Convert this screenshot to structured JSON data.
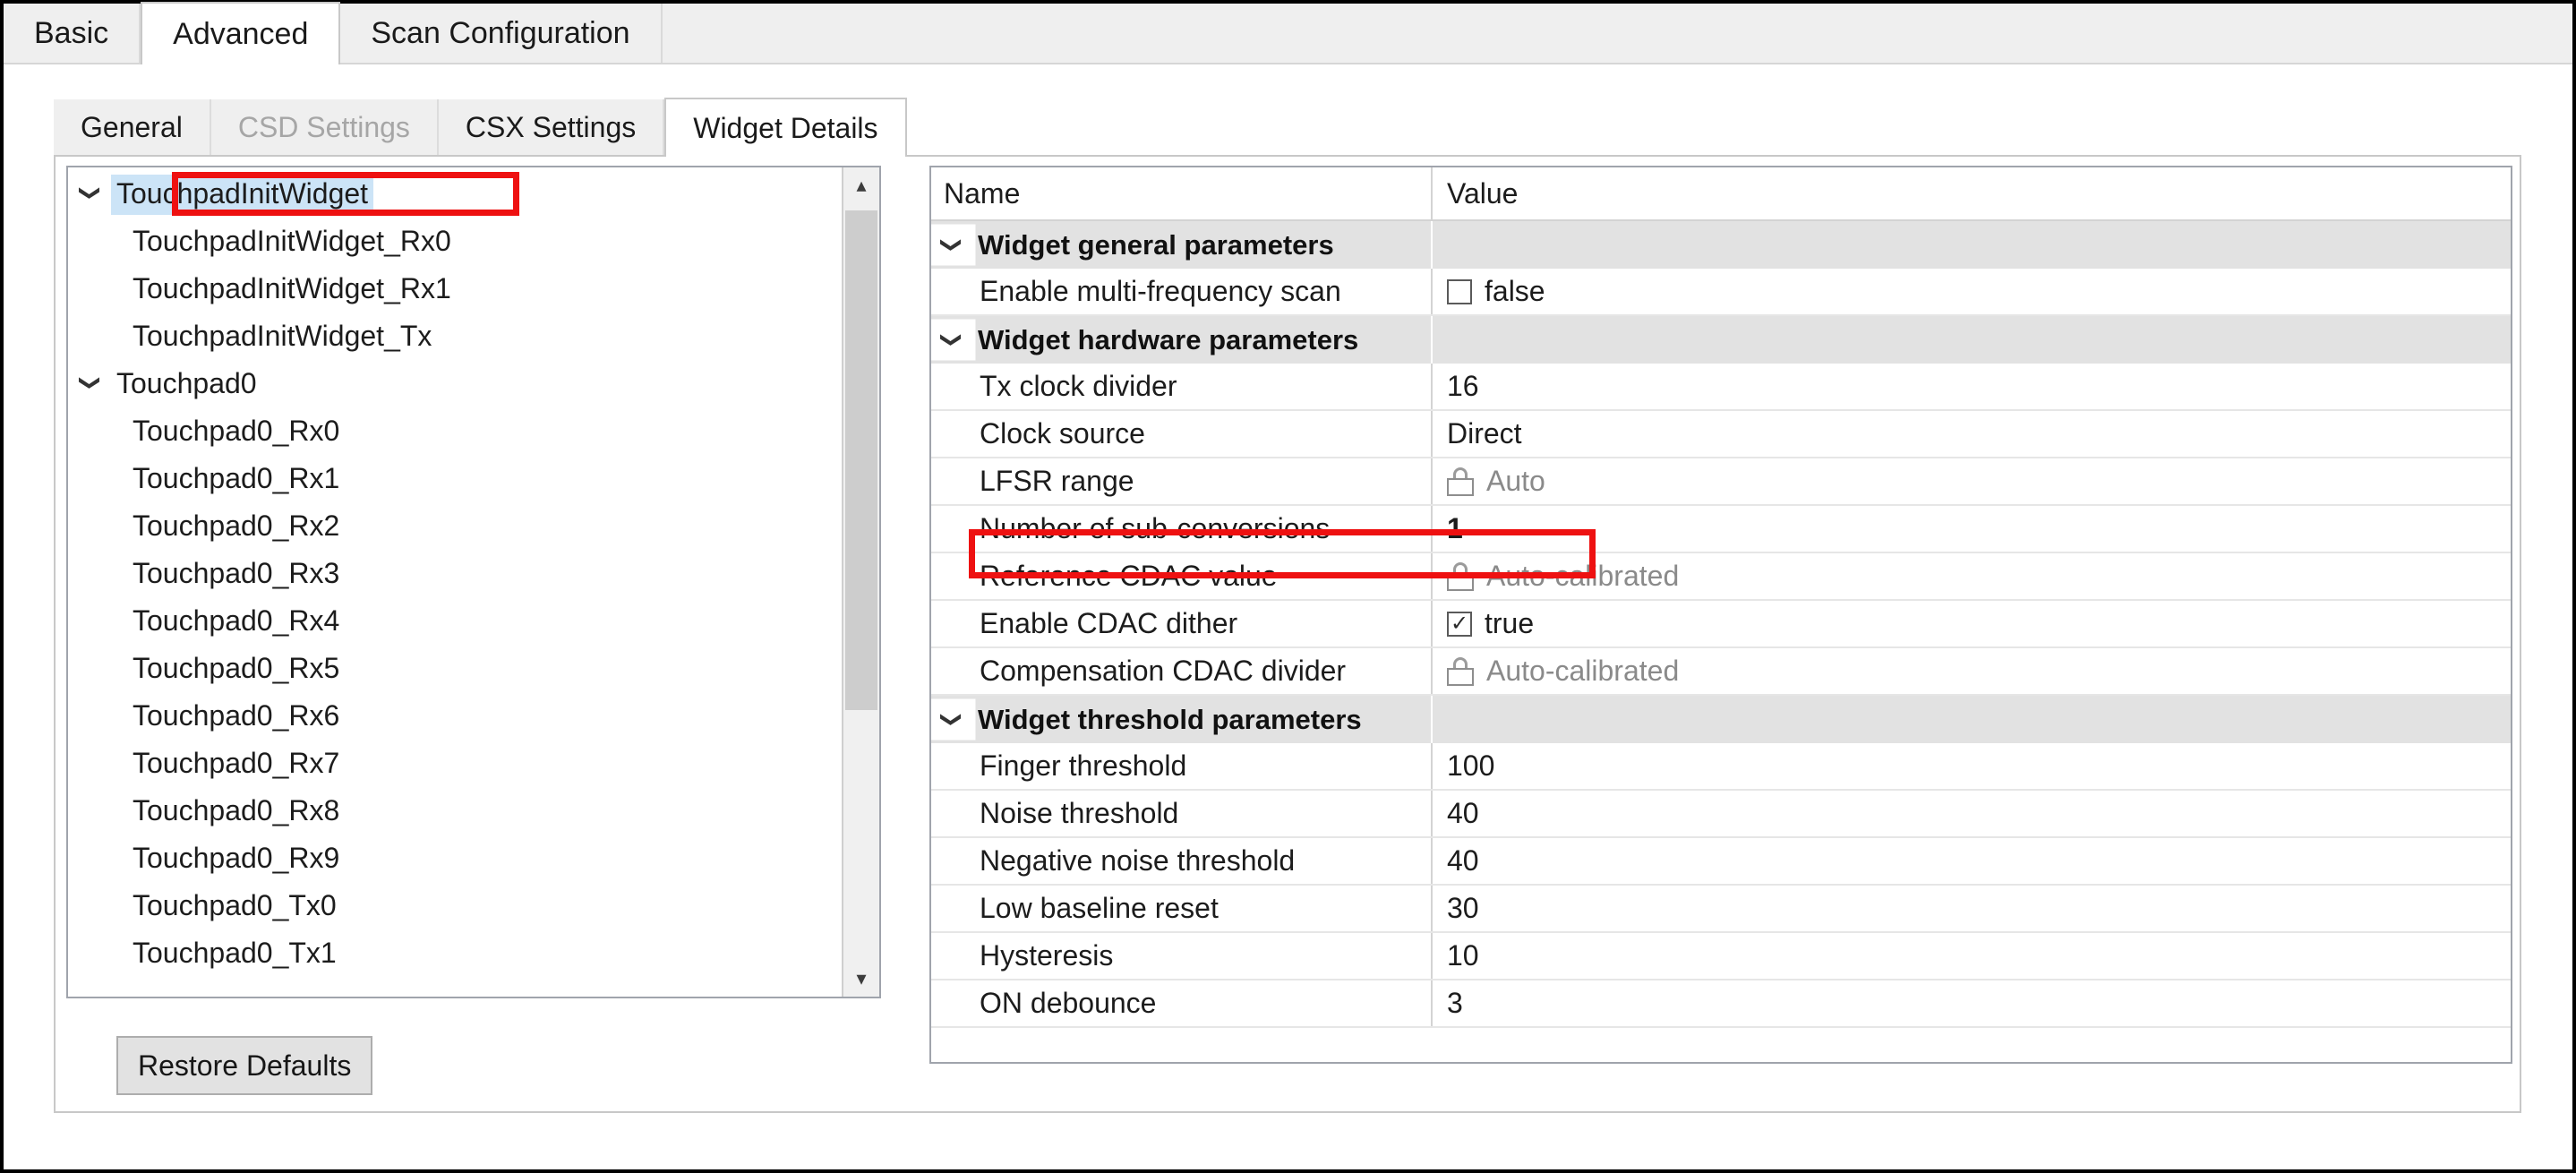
{
  "outer_tabs": [
    {
      "label": "Basic",
      "active": false
    },
    {
      "label": "Advanced",
      "active": true
    },
    {
      "label": "Scan Configuration",
      "active": false
    }
  ],
  "inner_tabs": [
    {
      "label": "General",
      "active": false,
      "disabled": false
    },
    {
      "label": "CSD Settings",
      "active": false,
      "disabled": true
    },
    {
      "label": "CSX Settings",
      "active": false,
      "disabled": false
    },
    {
      "label": "Widget Details",
      "active": true,
      "disabled": false
    }
  ],
  "tree": {
    "items": [
      {
        "label": "TouchpadInitWidget",
        "level": 1,
        "chevron": "expanded",
        "selected": true
      },
      {
        "label": "TouchpadInitWidget_Rx0",
        "level": 2,
        "chevron": "none",
        "selected": false
      },
      {
        "label": "TouchpadInitWidget_Rx1",
        "level": 2,
        "chevron": "none",
        "selected": false
      },
      {
        "label": "TouchpadInitWidget_Tx",
        "level": 2,
        "chevron": "none",
        "selected": false
      },
      {
        "label": "Touchpad0",
        "level": 1,
        "chevron": "expanded",
        "selected": false
      },
      {
        "label": "Touchpad0_Rx0",
        "level": 2,
        "chevron": "none",
        "selected": false
      },
      {
        "label": "Touchpad0_Rx1",
        "level": 2,
        "chevron": "none",
        "selected": false
      },
      {
        "label": "Touchpad0_Rx2",
        "level": 2,
        "chevron": "none",
        "selected": false
      },
      {
        "label": "Touchpad0_Rx3",
        "level": 2,
        "chevron": "none",
        "selected": false
      },
      {
        "label": "Touchpad0_Rx4",
        "level": 2,
        "chevron": "none",
        "selected": false
      },
      {
        "label": "Touchpad0_Rx5",
        "level": 2,
        "chevron": "none",
        "selected": false
      },
      {
        "label": "Touchpad0_Rx6",
        "level": 2,
        "chevron": "none",
        "selected": false
      },
      {
        "label": "Touchpad0_Rx7",
        "level": 2,
        "chevron": "none",
        "selected": false
      },
      {
        "label": "Touchpad0_Rx8",
        "level": 2,
        "chevron": "none",
        "selected": false
      },
      {
        "label": "Touchpad0_Rx9",
        "level": 2,
        "chevron": "none",
        "selected": false
      },
      {
        "label": "Touchpad0_Tx0",
        "level": 2,
        "chevron": "none",
        "selected": false
      },
      {
        "label": "Touchpad0_Tx1",
        "level": 2,
        "chevron": "none",
        "selected": false
      }
    ],
    "scrollbar": {
      "up_icon": "chevron-up-icon",
      "down_icon": "chevron-down-icon"
    }
  },
  "restore_button": {
    "label": "Restore Defaults"
  },
  "table": {
    "headers": {
      "name": "Name",
      "value": "Value"
    },
    "groups": [
      {
        "label": "Widget general parameters",
        "chevron": "expanded",
        "rows": [
          {
            "name": "Enable multi-frequency scan",
            "value": "false",
            "kind": "checkbox",
            "checked": false
          }
        ]
      },
      {
        "label": "Widget hardware parameters",
        "chevron": "expanded",
        "rows": [
          {
            "name": "Tx clock divider",
            "value": "16",
            "kind": "text"
          },
          {
            "name": "Clock source",
            "value": "Direct",
            "kind": "text"
          },
          {
            "name": "LFSR range",
            "value": "Auto",
            "kind": "locked"
          },
          {
            "name": "Number of sub-conversions",
            "value": "1",
            "kind": "bold",
            "highlighted": true
          },
          {
            "name": "Reference CDAC value",
            "value": "Auto-calibrated",
            "kind": "locked"
          },
          {
            "name": "Enable CDAC dither",
            "value": "true",
            "kind": "checkbox",
            "checked": true
          },
          {
            "name": "Compensation CDAC divider",
            "value": "Auto-calibrated",
            "kind": "locked"
          }
        ]
      },
      {
        "label": "Widget threshold parameters",
        "chevron": "expanded",
        "rows": [
          {
            "name": "Finger threshold",
            "value": "100",
            "kind": "text"
          },
          {
            "name": "Noise threshold",
            "value": "40",
            "kind": "text"
          },
          {
            "name": "Negative noise threshold",
            "value": "40",
            "kind": "text"
          },
          {
            "name": "Low baseline reset",
            "value": "30",
            "kind": "text"
          },
          {
            "name": "Hysteresis",
            "value": "10",
            "kind": "text"
          },
          {
            "name": "ON debounce",
            "value": "3",
            "kind": "text"
          }
        ]
      }
    ]
  },
  "colors": {
    "highlight_red": "#ee1111",
    "selection_blue": "#cce4f7",
    "group_gray": "#e2e2e2",
    "locked_text": "#8a8a8a"
  }
}
